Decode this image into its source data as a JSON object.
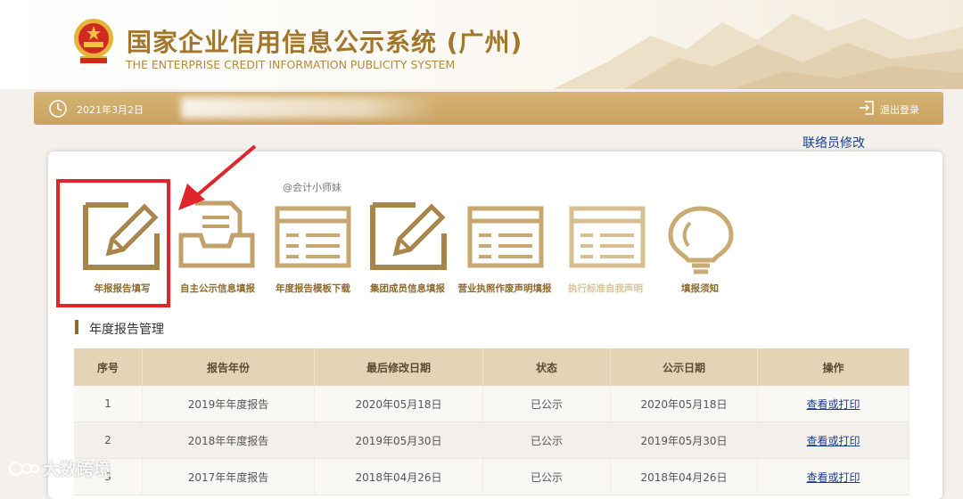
{
  "header": {
    "title_cn": "国家企业信用信息公示系统 (广州)",
    "title_en": "THE ENTERPRISE CREDIT INFORMATION PUBLICITY SYSTEM"
  },
  "bar": {
    "date": "2021年3月2日",
    "logout_label": "退出登录"
  },
  "liaison_link": "联络员修改",
  "watermark": "@会计小师妹",
  "icons": [
    {
      "label": "年报报告填写",
      "icon": "pencil-edit-icon"
    },
    {
      "label": "自主公示信息填报",
      "icon": "inbox-tray-icon"
    },
    {
      "label": "年度报告模板下载",
      "icon": "document-template-icon"
    },
    {
      "label": "集团成员信息填报",
      "icon": "pencil-edit-icon"
    },
    {
      "label": "营业执照作废声明填报",
      "icon": "document-template-icon"
    },
    {
      "label": "执行标准自我声明",
      "icon": "document-template-icon"
    },
    {
      "label": "填报须知",
      "icon": "lightbulb-icon"
    }
  ],
  "section_title": "年度报告管理",
  "table": {
    "headers": [
      "序号",
      "报告年份",
      "最后修改日期",
      "状态",
      "公示日期",
      "操作"
    ],
    "rows": [
      [
        "1",
        "2019年年度报告",
        "2020年05月18日",
        "已公示",
        "2020年05月18日",
        "查看或打印"
      ],
      [
        "2",
        "2018年年度报告",
        "2019年05月30日",
        "已公示",
        "2019年05月30日",
        "查看或打印"
      ],
      [
        "3",
        "2017年年度报告",
        "2018年04月26日",
        "已公示",
        "2018年04月26日",
        "查看或打印"
      ]
    ]
  },
  "corner_watermark": "大数跨境",
  "colors": {
    "gold": "#a2762b",
    "bar": "#d6b474",
    "highlight": "#e0262b",
    "link": "#1a3d8f"
  }
}
